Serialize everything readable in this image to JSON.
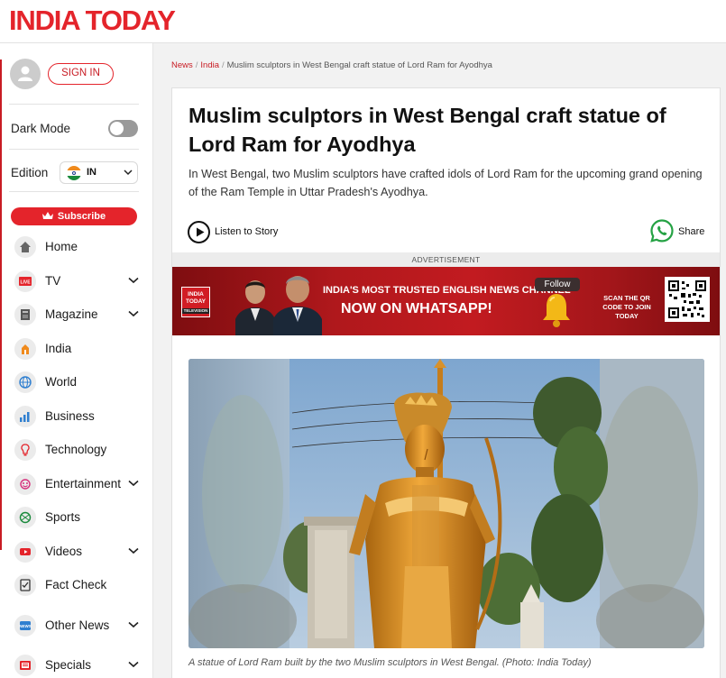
{
  "header": {
    "logo_text": "INDIA TODAY"
  },
  "sidebar": {
    "sign_in_label": "SIGN IN",
    "dark_mode_label": "Dark Mode",
    "dark_mode_on": false,
    "edition_label": "Edition",
    "edition_value": "IN",
    "subscribe_label": "Subscribe",
    "items": [
      {
        "label": "Home",
        "icon": "home-icon",
        "expandable": false
      },
      {
        "label": "TV",
        "icon": "live-tv-icon",
        "expandable": true
      },
      {
        "label": "Magazine",
        "icon": "magazine-icon",
        "expandable": true
      },
      {
        "label": "India",
        "icon": "india-icon",
        "expandable": false
      },
      {
        "label": "World",
        "icon": "globe-icon",
        "expandable": false
      },
      {
        "label": "Business",
        "icon": "business-chart-icon",
        "expandable": false
      },
      {
        "label": "Technology",
        "icon": "technology-icon",
        "expandable": false
      },
      {
        "label": "Entertainment",
        "icon": "entertainment-icon",
        "expandable": true
      },
      {
        "label": "Sports",
        "icon": "sports-icon",
        "expandable": false
      },
      {
        "label": "Videos",
        "icon": "video-icon",
        "expandable": true
      },
      {
        "label": "Fact Check",
        "icon": "fact-check-icon",
        "expandable": false
      },
      {
        "label": "Other News",
        "icon": "news-icon",
        "expandable": true
      },
      {
        "label": "Specials",
        "icon": "specials-icon",
        "expandable": true
      }
    ]
  },
  "breadcrumb": {
    "items": [
      "News",
      "India"
    ],
    "current": "Muslim sculptors in West Bengal craft statue of Lord Ram for Ayodhya"
  },
  "article": {
    "headline": "Muslim sculptors in West Bengal craft statue of Lord Ram for Ayodhya",
    "summary": "In West Bengal, two Muslim sculptors have crafted idols of Lord Ram for the upcoming grand opening of the Ram Temple in Uttar Pradesh's Ayodhya.",
    "listen_label": "Listen to Story",
    "share_label": "Share",
    "caption": "A statue of Lord Ram built by the two Muslim sculptors in West Bengal. (Photo: India Today)"
  },
  "ad": {
    "label": "ADVERTISEMENT",
    "logo_text": "INDIA TODAY",
    "logo_sub": "TELEVISION",
    "line1": "INDIA'S MOST TRUSTED ENGLISH NEWS CHANNEL",
    "line2": "NOW ON WHATSAPP!",
    "follow_label": "Follow",
    "qr_text": "SCAN THE QR CODE TO JOIN TODAY"
  },
  "colors": {
    "brand_red": "#e4242b",
    "whatsapp_green": "#25a244"
  }
}
